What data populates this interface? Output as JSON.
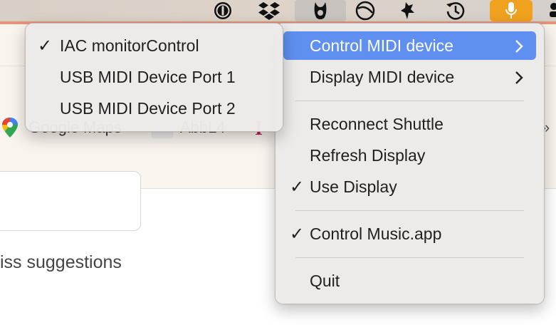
{
  "menubar": {
    "icons": [
      "1password-icon",
      "dropbox-icon",
      "shuttle-app-icon",
      "sync-icon",
      "bug-icon",
      "time-machine-icon",
      "microphone-icon",
      "overflow-icon"
    ]
  },
  "browser": {
    "bookmarks": [
      "Google Maps",
      "AbbL4"
    ],
    "content_text": "iss suggestions"
  },
  "main_menu": {
    "items": [
      {
        "label": "Control MIDI device",
        "submenu": true,
        "checked": false,
        "highlighted": true
      },
      {
        "label": "Display MIDI device",
        "submenu": true,
        "checked": false,
        "highlighted": false
      },
      {
        "label": "Reconnect Shuttle",
        "submenu": false,
        "checked": false,
        "highlighted": false
      },
      {
        "label": "Refresh Display",
        "submenu": false,
        "checked": false,
        "highlighted": false
      },
      {
        "label": "Use Display",
        "submenu": false,
        "checked": true,
        "highlighted": false
      },
      {
        "label": "Control Music.app",
        "submenu": false,
        "checked": true,
        "highlighted": false
      },
      {
        "label": "Quit",
        "submenu": false,
        "checked": false,
        "highlighted": false
      }
    ]
  },
  "sub_menu": {
    "items": [
      {
        "label": "IAC monitorControl",
        "checked": true
      },
      {
        "label": "USB MIDI Device Port 1",
        "checked": false
      },
      {
        "label": "USB MIDI Device Port 2",
        "checked": false
      }
    ]
  },
  "symbols": {
    "check": "✓",
    "arrow": "chevron-right-icon",
    "chevrons": "»"
  },
  "colors": {
    "highlight": "#5f8ff0",
    "mic_bg": "#f0a21f"
  }
}
